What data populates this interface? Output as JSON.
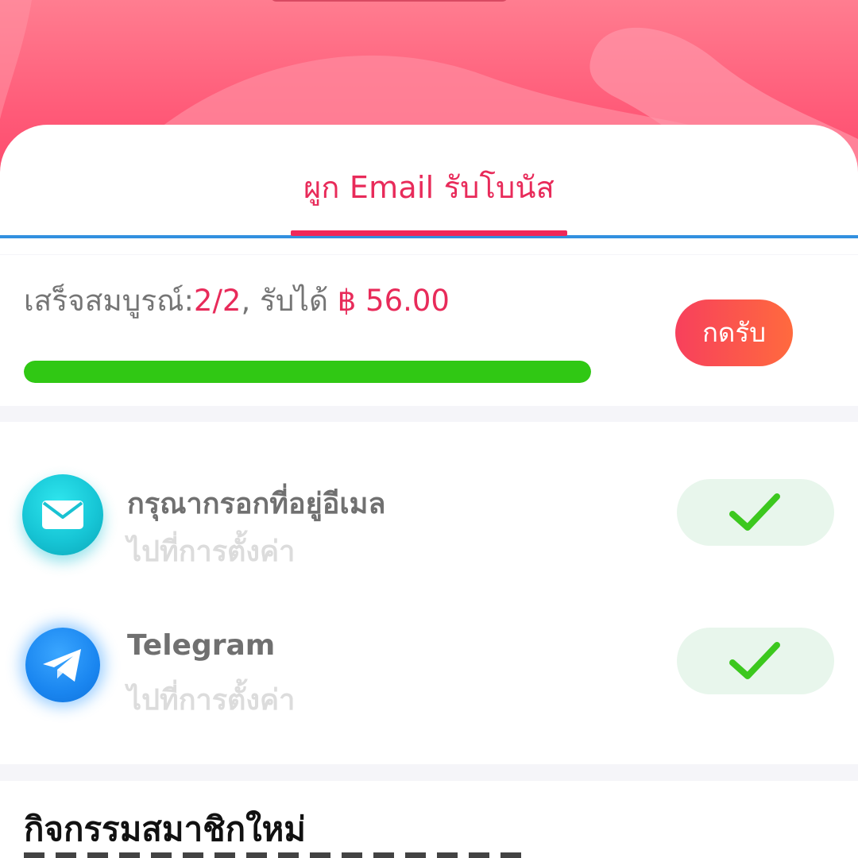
{
  "header": {
    "tab_label": "ผูก Email รับโบนัส"
  },
  "progress": {
    "label": "เสร็จสมบูรณ์:",
    "completed": "2/2",
    "separator": ", รับได้ ",
    "reward": "฿ 56.00",
    "fill_fraction": 1.0,
    "claim_button_label": "กดรับ"
  },
  "tasks": [
    {
      "title": "กรุณากรอกที่อยู่อีเมล",
      "subtitle": "ไปที่การตั้งค่า",
      "icon": "mail-icon",
      "status_icon": "check-icon",
      "done": true
    },
    {
      "title": "Telegram",
      "subtitle": "ไปที่การตั้งค่า",
      "icon": "telegram-icon",
      "status_icon": "check-icon",
      "done": true
    }
  ],
  "bottom": {
    "title": "กิจกรรมสมาชิกใหม่"
  },
  "colors": {
    "accent": "#e82b5a",
    "progress_fill": "#30c814",
    "tab_rule": "#3290e0",
    "check": "#3cc81e"
  }
}
